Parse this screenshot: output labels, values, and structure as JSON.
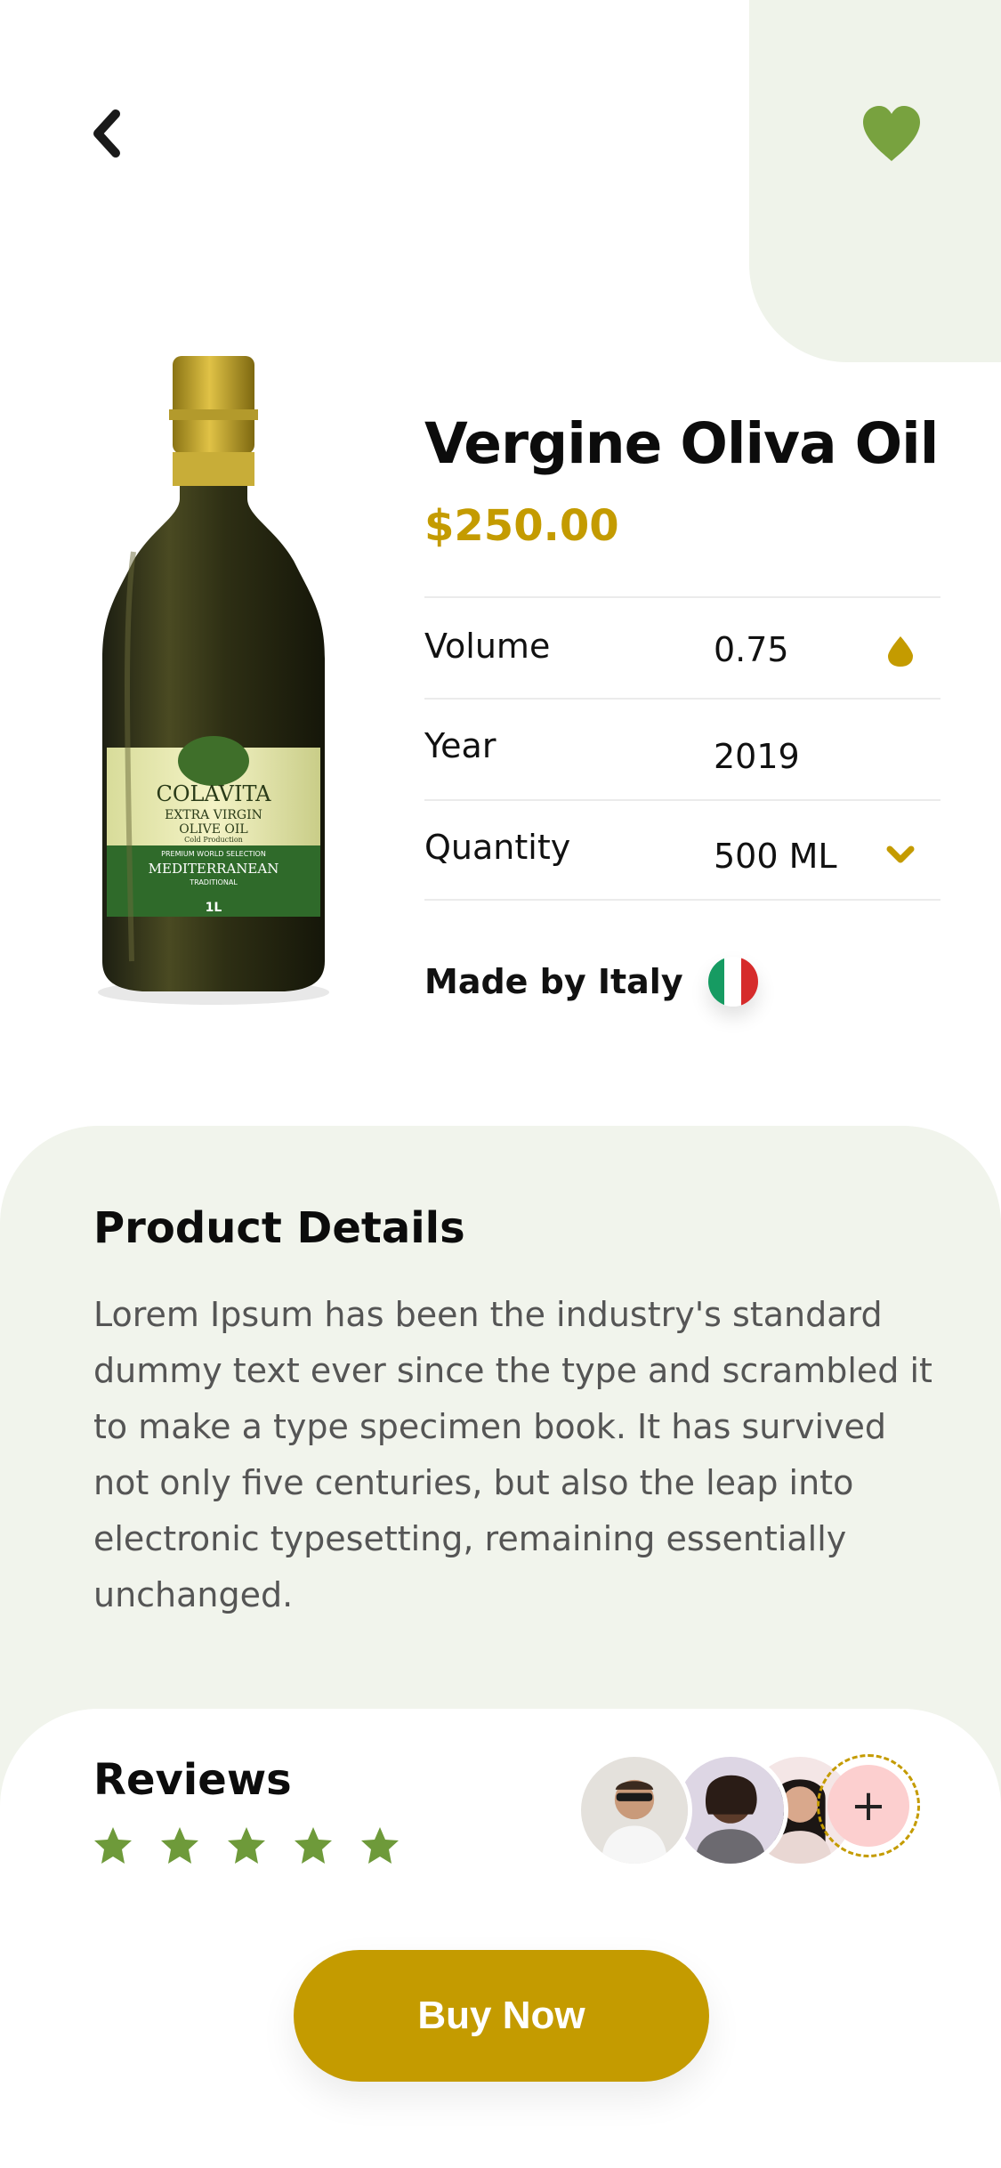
{
  "product": {
    "name": "Vergine Oliva Oil",
    "price": "$250.00",
    "specs": [
      {
        "label": "Volume",
        "value": "0.75",
        "icon": "drop-icon"
      },
      {
        "label": "Year",
        "value": "2019",
        "icon": ""
      },
      {
        "label": "Quantity",
        "value": "500 ML",
        "icon": "chevron-down-icon"
      }
    ],
    "origin_label": "Made by Italy",
    "origin_flag": "italy-flag-icon"
  },
  "details": {
    "title": "Product Details",
    "body": "Lorem Ipsum has been the industry's standard dummy text ever since the type and scrambled it to make a type specimen book. It has survived not only five centuries, but also the leap into electronic typesetting, remaining essentially unchanged."
  },
  "reviews": {
    "title": "Reviews",
    "rating": 5,
    "max_rating": 5,
    "add_label": "+"
  },
  "actions": {
    "buy_label": "Buy Now"
  },
  "bottle_label": {
    "brand": "COLAVITA",
    "line1": "EXTRA VIRGIN",
    "line2": "OLIVE OIL",
    "line3": "Cold Production",
    "band": "PREMIUM WORLD SELECTION",
    "variety": "MEDITERRANEAN",
    "style": "TRADITIONAL",
    "size": "1L"
  },
  "colors": {
    "accent": "#c49b00",
    "heart": "#78a23f",
    "star": "#6e9a3a",
    "panel": "#f1f4ec"
  }
}
